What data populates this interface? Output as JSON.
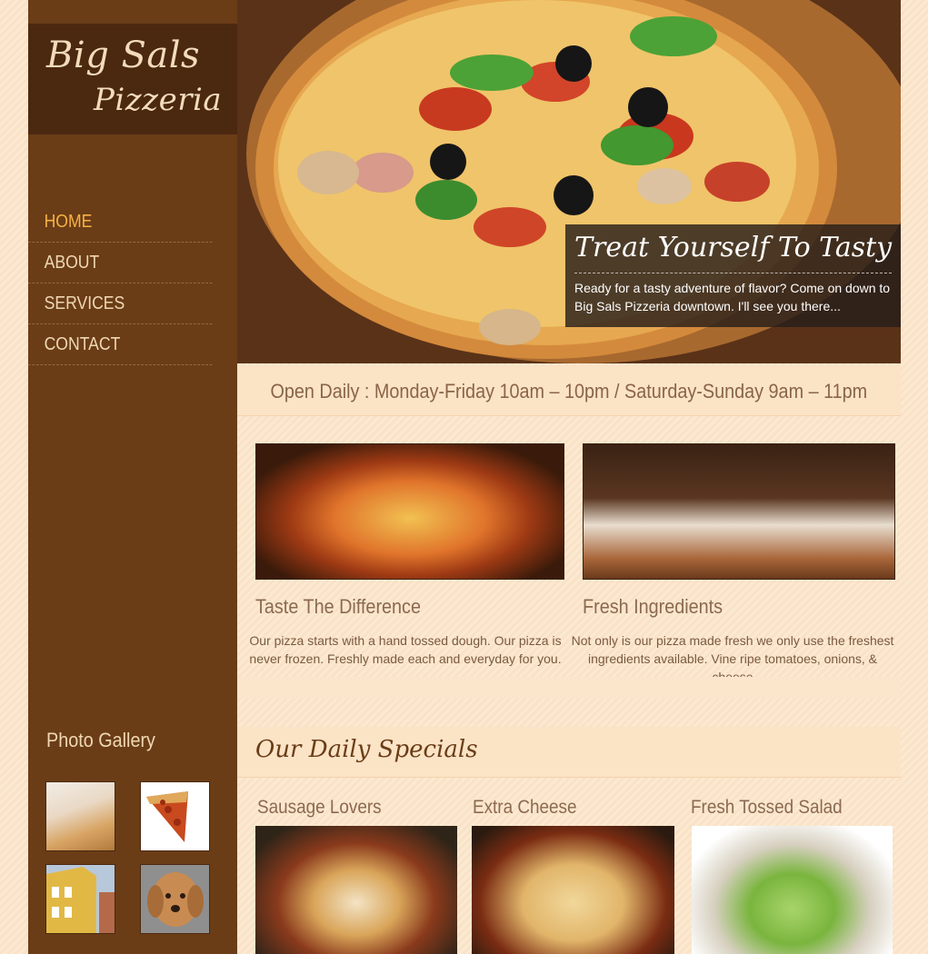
{
  "brand": {
    "line1": "Big Sals",
    "line2": "Pizzeria"
  },
  "nav": {
    "items": [
      {
        "label": "HOME",
        "active": true
      },
      {
        "label": "ABOUT",
        "active": false
      },
      {
        "label": "SERVICES",
        "active": false
      },
      {
        "label": "CONTACT",
        "active": false
      }
    ]
  },
  "gallery": {
    "title": "Photo Gallery"
  },
  "hero": {
    "title": "Treat Yourself To Tasty",
    "text": "Ready for a tasty adventure of flavor? Come on down to Big Sals Pizzeria downtown. I'll see you there..."
  },
  "hours": {
    "text": "Open Daily : Monday-Friday 10am – 10pm / Saturday-Sunday 9am – 11pm"
  },
  "features": [
    {
      "title": "Taste The Difference",
      "text": "Our pizza starts with a hand tossed dough. Our pizza is never frozen. Freshly made each and everyday for you."
    },
    {
      "title": "Fresh Ingredients",
      "text": "Not only is our pizza made fresh we only use the freshest ingredients available. Vine ripe tomatoes, onions, & cheese"
    }
  ],
  "specials": {
    "title": "Our Daily Specials",
    "items": [
      {
        "title": "Sausage Lovers"
      },
      {
        "title": "Extra Cheese"
      },
      {
        "title": "Fresh Tossed Salad"
      }
    ]
  },
  "colors": {
    "sidebar": "#6a3d17",
    "logo_box": "#4b2810",
    "nav_active": "#f7b144",
    "nav_text": "#f0d7b3",
    "page_background": "#fce9d2"
  }
}
